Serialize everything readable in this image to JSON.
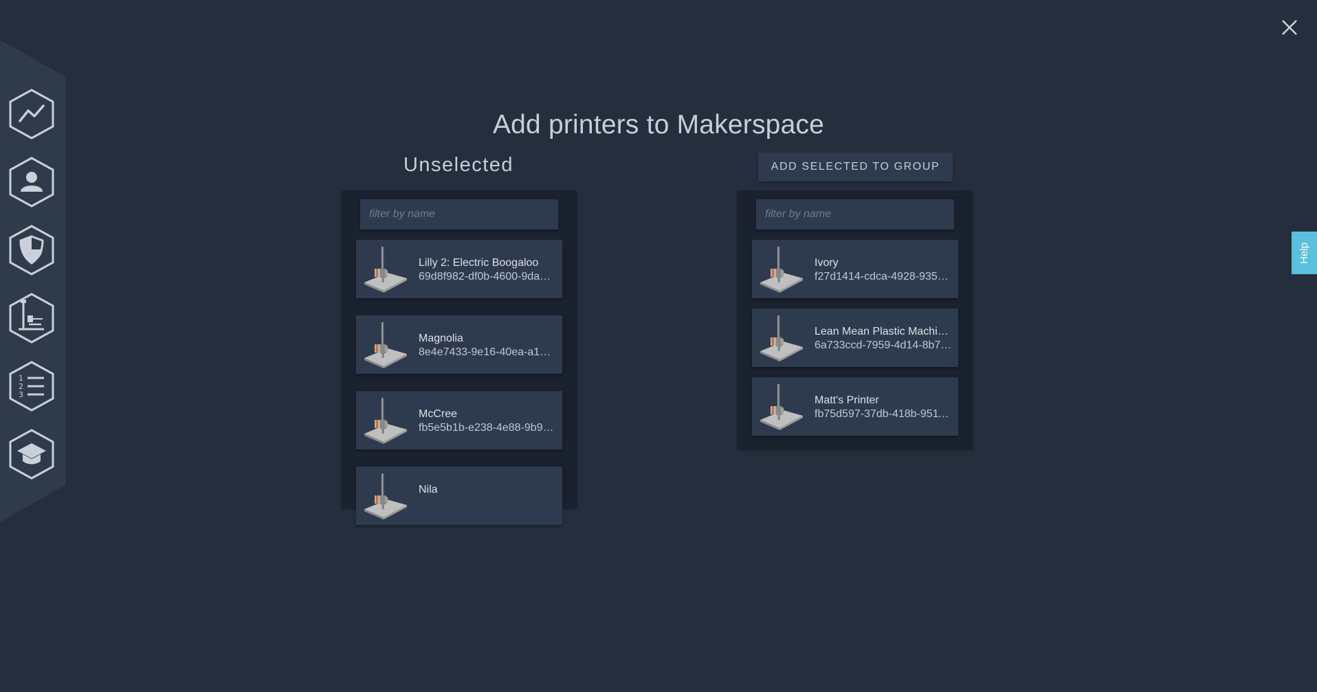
{
  "page": {
    "title": "Add printers to Makerspace",
    "close_icon": "close-icon"
  },
  "colors": {
    "background": "#242e3d",
    "panel": "#1a2230",
    "card": "#2e3a4d",
    "help": "#5bc0de"
  },
  "sidebar": {
    "items": [
      {
        "icon": "trend-chart-icon"
      },
      {
        "icon": "user-icon"
      },
      {
        "icon": "shield-icon"
      },
      {
        "icon": "printer-icon"
      },
      {
        "icon": "numbered-list-icon"
      },
      {
        "icon": "graduation-cap-icon"
      }
    ]
  },
  "unselected": {
    "heading": "Unselected",
    "filter_placeholder": "filter by name",
    "printers": [
      {
        "name": "Lilly 2: Electric Boogaloo",
        "id": "69d8f982-df0b-4600-9da2-..."
      },
      {
        "name": "Magnolia",
        "id": "8e4e7433-9e16-40ea-a1ea..."
      },
      {
        "name": "McCree",
        "id": "fb5e5b1b-e238-4e88-9b96..."
      },
      {
        "name": "Nila",
        "id": ""
      }
    ]
  },
  "selected": {
    "add_button_label": "ADD SELECTED TO GROUP",
    "filter_placeholder": "filter by name",
    "printers": [
      {
        "name": "Ivory",
        "id": "f27d1414-cdca-4928-9350..."
      },
      {
        "name": "Lean Mean Plastic Machin...",
        "id": "6a733ccd-7959-4d14-8b73..."
      },
      {
        "name": "Matt's Printer",
        "id": "fb75d597-37db-418b-9511..."
      }
    ]
  },
  "help": {
    "label": "Help"
  }
}
